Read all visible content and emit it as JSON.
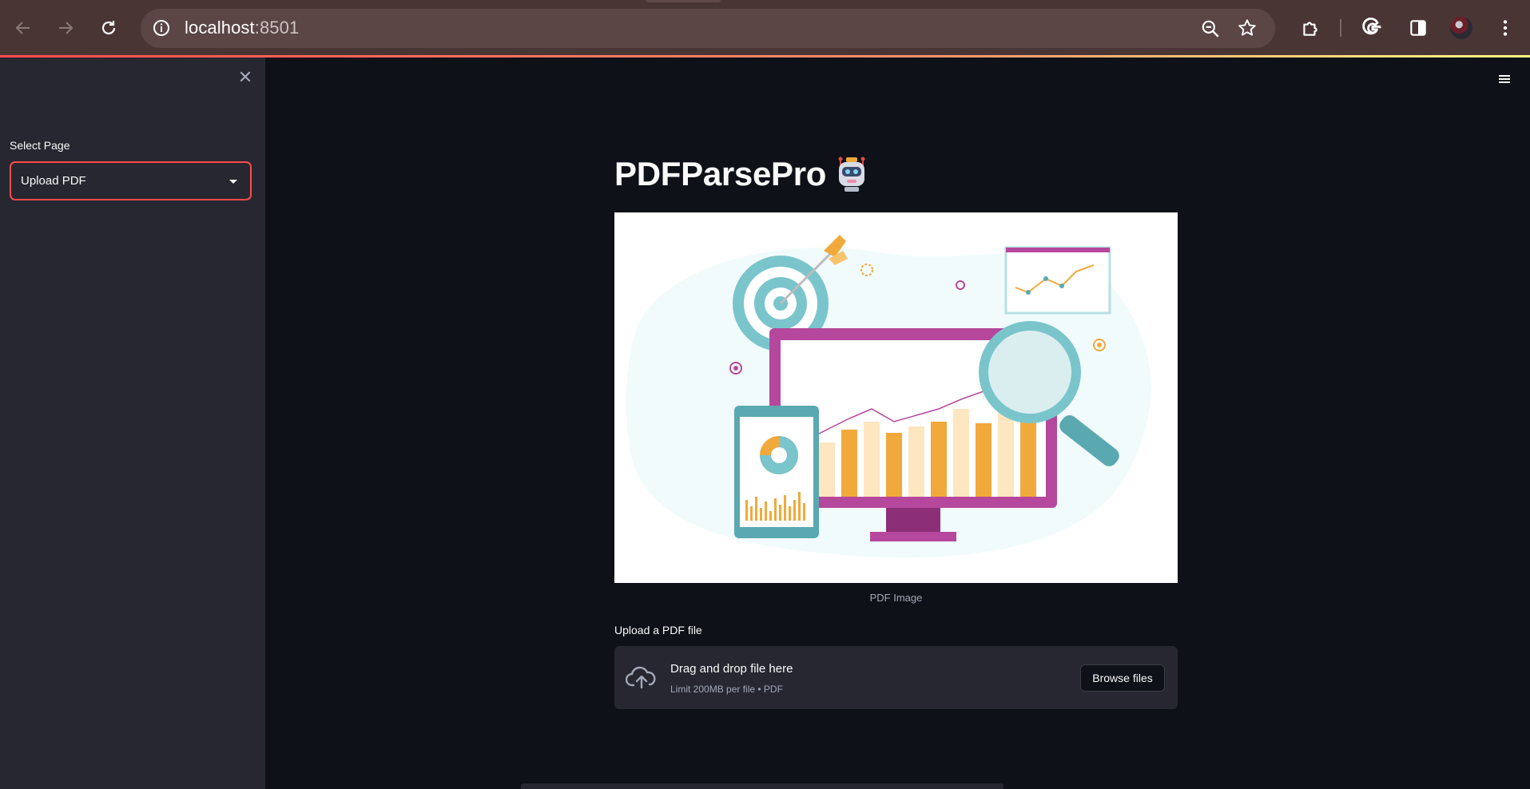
{
  "browser": {
    "url_host": "localhost",
    "url_port": ":8501"
  },
  "sidebar": {
    "close_glyph": "✕",
    "select_label": "Select Page",
    "select_value": "Upload PDF"
  },
  "main": {
    "title": "PDFParsePro",
    "image_caption": "PDF Image",
    "upload_label": "Upload a PDF file",
    "dropzone_title": "Drag and drop file here",
    "dropzone_sub": "Limit 200MB per file • PDF",
    "browse_label": "Browse files"
  },
  "colors": {
    "accent": "#ff4b4b",
    "app_bg": "#0e1117",
    "sidebar_bg": "#262730",
    "chrome_bg": "#4a3535"
  }
}
